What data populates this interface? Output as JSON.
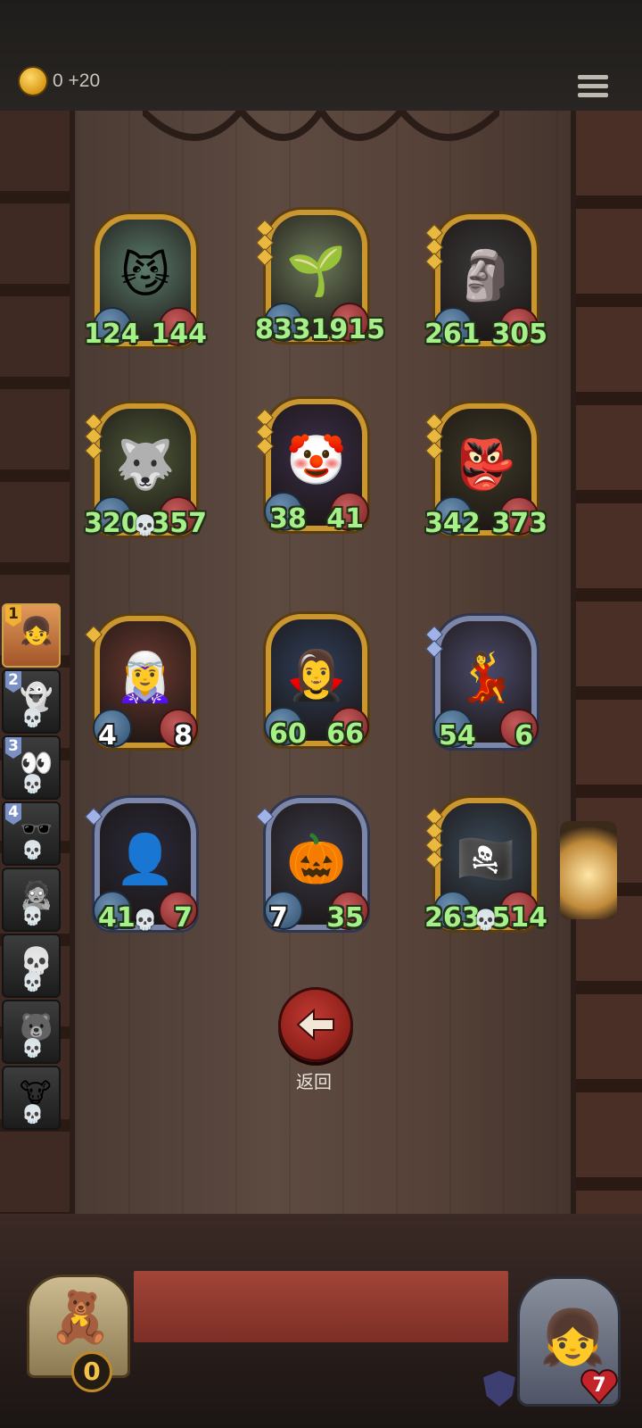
{
  "header": {
    "gold_text": "0 +20",
    "coin_icon": "crown-coin-icon",
    "menu_icon": "menu-icon"
  },
  "cards": [
    {
      "name": "blue-spotted-imp",
      "frame": "gold",
      "gems": 0,
      "atk": "124",
      "hp": "144",
      "skull": false,
      "face": "😼",
      "bg": "#5a7a6a"
    },
    {
      "name": "leaf-haired-sprout",
      "frame": "gold",
      "gems": 3,
      "atk": "833",
      "hp": "1915",
      "skull": false,
      "face": "🌱",
      "bg": "#6b7a5a"
    },
    {
      "name": "iron-mask-golem",
      "frame": "gold",
      "gems": 3,
      "atk": "261",
      "hp": "305",
      "skull": false,
      "face": "🗿",
      "bg": "#3a3a3a"
    },
    {
      "name": "flower-hat-wolf",
      "frame": "gold",
      "gems": 3,
      "atk": "320",
      "hp": "357",
      "skull": true,
      "face": "🐺",
      "bg": "#4e5a3a"
    },
    {
      "name": "jester-clown",
      "frame": "gold",
      "gems": 3,
      "atk": "38",
      "hp": "41",
      "skull": false,
      "face": "🤡",
      "bg": "#3a2e4a"
    },
    {
      "name": "hooded-goblin",
      "frame": "gold",
      "gems": 3,
      "atk": "342",
      "hp": "373",
      "skull": false,
      "face": "👺",
      "bg": "#3e3a28"
    },
    {
      "name": "red-haired-seer",
      "frame": "gold",
      "gems": 1,
      "atk": "4",
      "hp": "8",
      "skull": false,
      "face": "🧝‍♀️",
      "bg": "#6a3a30",
      "white_stats": true
    },
    {
      "name": "blue-elf-witch",
      "frame": "gold",
      "gems": 0,
      "atk": "60",
      "hp": "66",
      "skull": false,
      "face": "🧛‍♀️",
      "bg": "#2f3f5a"
    },
    {
      "name": "masked-dancer",
      "frame": "silver",
      "gems": 2,
      "atk": "54",
      "hp": "6",
      "skull": false,
      "face": "💃",
      "bg": "#4a4a6a"
    },
    {
      "name": "shadow-reaper",
      "frame": "silver",
      "gems": 1,
      "atk": "41",
      "hp": "7",
      "skull": true,
      "face": "👤",
      "bg": "#2a2a3a"
    },
    {
      "name": "pumpkin-lock-knight",
      "frame": "silver",
      "gems": 1,
      "atk": "7",
      "hp": "35",
      "skull": false,
      "face": "🎃",
      "bg": "#3a3a4a",
      "atk_white": true
    },
    {
      "name": "pirate-captain",
      "frame": "gold",
      "gems": 4,
      "atk": "263",
      "hp": "514",
      "skull": true,
      "face": "🏴‍☠️",
      "bg": "#3a4a5a"
    }
  ],
  "roster": [
    {
      "num": "1",
      "active": true,
      "face": "👧"
    },
    {
      "num": "2",
      "active": false,
      "face": "👻"
    },
    {
      "num": "3",
      "active": false,
      "face": "👀"
    },
    {
      "num": "4",
      "active": false,
      "face": "🕶️"
    },
    {
      "num": "",
      "active": false,
      "face": "🧟"
    },
    {
      "num": "",
      "active": false,
      "face": "💀"
    },
    {
      "num": "",
      "active": false,
      "face": "🐻"
    },
    {
      "num": "",
      "active": false,
      "face": "🐮"
    }
  ],
  "back": {
    "label": "返回",
    "icon": "arrow-left-icon"
  },
  "doll": {
    "count": "0",
    "icon": "voodoo-doll-icon"
  },
  "hero": {
    "hp": "7",
    "icon": "red-haired-girl-portrait",
    "shield_icon": "shield-icon",
    "heart_icon": "heart-icon"
  }
}
